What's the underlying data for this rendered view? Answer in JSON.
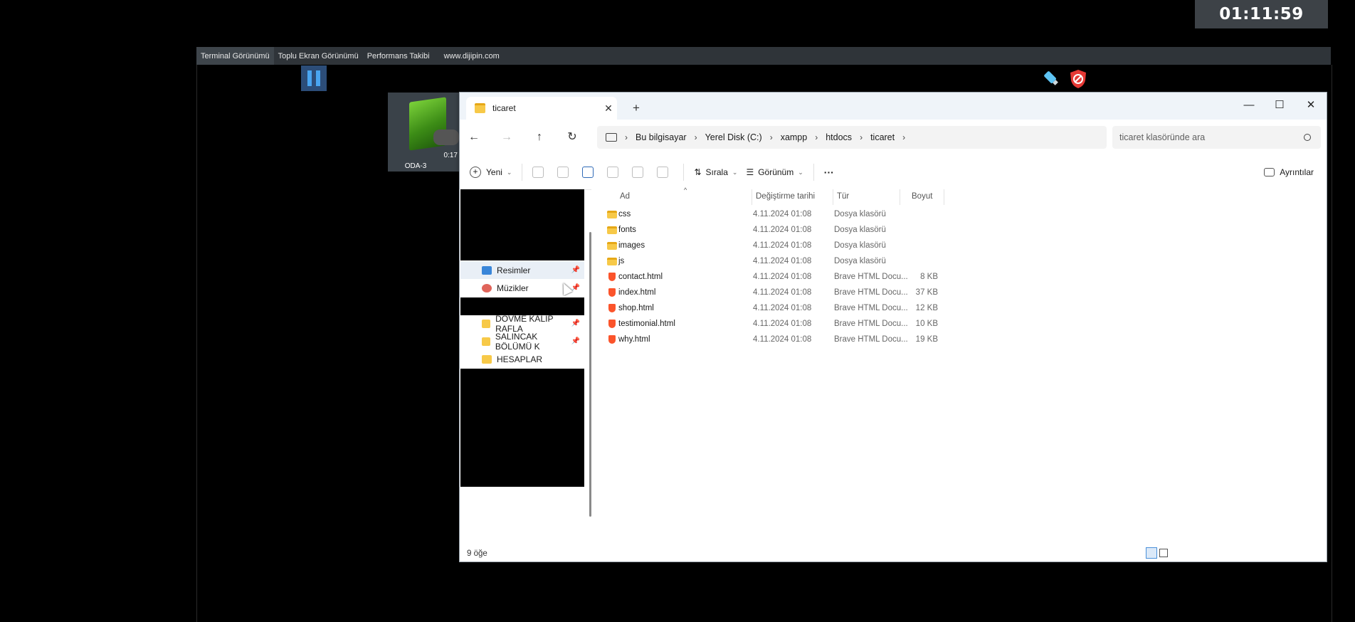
{
  "timer": "01:11:59",
  "host_menu": [
    {
      "label": "Terminal Görünümü"
    },
    {
      "label": "Toplu Ekran Görünümü"
    },
    {
      "label": "Performans Takibi"
    },
    {
      "label": "www.dijipin.com"
    }
  ],
  "tile": {
    "name": "ODA-3",
    "time": "0:17"
  },
  "explorer": {
    "tab_title": "ticaret",
    "breadcrumb": [
      "Bu bilgisayar",
      "Yerel Disk (C:)",
      "xampp",
      "htdocs",
      "ticaret"
    ],
    "search_placeholder": "ticaret klasöründe ara",
    "commands": {
      "new": "Yeni",
      "sort": "Sırala",
      "view": "Görünüm",
      "more": "···",
      "details": "Ayrıntılar"
    },
    "nav": {
      "pictures": "Resimler",
      "music": "Müzikler",
      "folder1": "DÖVME KALIP RAFLA",
      "folder2": "SALINCAK BÖLÜMÜ K",
      "folder3": "HESAPLAR"
    },
    "columns": {
      "name": "Ad",
      "date": "Değiştirme tarihi",
      "type": "Tür",
      "size": "Boyut"
    },
    "files": [
      {
        "name": "css",
        "date": "4.11.2024 01:08",
        "type": "Dosya klasörü",
        "size": "",
        "kind": "folder"
      },
      {
        "name": "fonts",
        "date": "4.11.2024 01:08",
        "type": "Dosya klasörü",
        "size": "",
        "kind": "folder"
      },
      {
        "name": "images",
        "date": "4.11.2024 01:08",
        "type": "Dosya klasörü",
        "size": "",
        "kind": "folder"
      },
      {
        "name": "js",
        "date": "4.11.2024 01:08",
        "type": "Dosya klasörü",
        "size": "",
        "kind": "folder"
      },
      {
        "name": "contact.html",
        "date": "4.11.2024 01:08",
        "type": "Brave HTML Docu...",
        "size": "8 KB",
        "kind": "html"
      },
      {
        "name": "index.html",
        "date": "4.11.2024 01:08",
        "type": "Brave HTML Docu...",
        "size": "37 KB",
        "kind": "html"
      },
      {
        "name": "shop.html",
        "date": "4.11.2024 01:08",
        "type": "Brave HTML Docu...",
        "size": "12 KB",
        "kind": "html"
      },
      {
        "name": "testimonial.html",
        "date": "4.11.2024 01:08",
        "type": "Brave HTML Docu...",
        "size": "10 KB",
        "kind": "html"
      },
      {
        "name": "why.html",
        "date": "4.11.2024 01:08",
        "type": "Brave HTML Docu...",
        "size": "19 KB",
        "kind": "html"
      }
    ],
    "status_count": "9 öğe"
  }
}
